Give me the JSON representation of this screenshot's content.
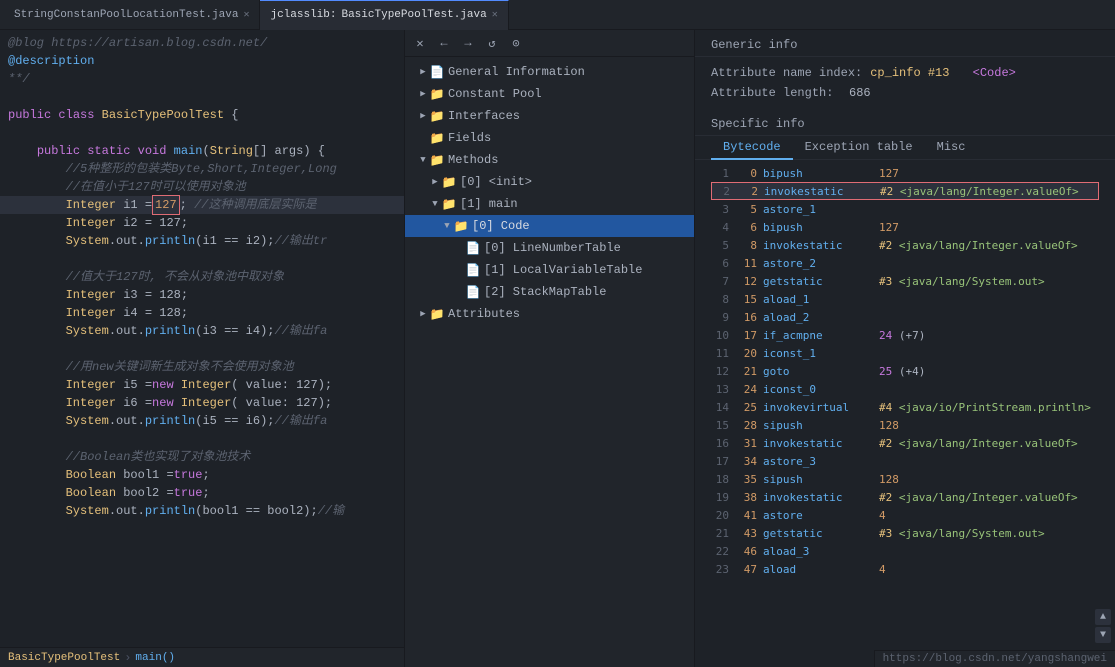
{
  "tabs": [
    {
      "id": "tab1",
      "label": "StringConstanPoolLocationTest.java",
      "active": false,
      "closeable": true
    },
    {
      "id": "tab2",
      "label": "BasicTypePoolTest.java",
      "active": true,
      "closeable": true
    }
  ],
  "tab_prefix": "jclasslib:",
  "toolbar": {
    "close": "✕",
    "back": "←",
    "forward": "→",
    "refresh": "↺",
    "stop": "⊙"
  },
  "tree": {
    "items": [
      {
        "id": "general",
        "label": "General Information",
        "indent": 0,
        "arrow": "▶",
        "icon": "📄",
        "expanded": false
      },
      {
        "id": "constant-pool",
        "label": "Constant Pool",
        "indent": 0,
        "arrow": "▶",
        "icon": "📁",
        "expanded": false
      },
      {
        "id": "interfaces",
        "label": "Interfaces",
        "indent": 0,
        "arrow": "▶",
        "icon": "📁",
        "expanded": false
      },
      {
        "id": "fields",
        "label": "Fields",
        "indent": 0,
        "arrow": "",
        "icon": "📁",
        "expanded": false
      },
      {
        "id": "methods",
        "label": "Methods",
        "indent": 0,
        "arrow": "▼",
        "icon": "📁",
        "expanded": true
      },
      {
        "id": "method-init",
        "label": "[0] <init>",
        "indent": 1,
        "arrow": "▶",
        "icon": "📁",
        "expanded": false
      },
      {
        "id": "method-main",
        "label": "[1] main",
        "indent": 1,
        "arrow": "▼",
        "icon": "📁",
        "expanded": true
      },
      {
        "id": "method-main-code",
        "label": "[0] Code",
        "indent": 2,
        "arrow": "▼",
        "icon": "📁",
        "expanded": true,
        "selected": true
      },
      {
        "id": "line-number-table",
        "label": "[0] LineNumberTable",
        "indent": 3,
        "arrow": "",
        "icon": "📄",
        "expanded": false
      },
      {
        "id": "local-var-table",
        "label": "[1] LocalVariableTable",
        "indent": 3,
        "arrow": "",
        "icon": "📄",
        "expanded": false
      },
      {
        "id": "stack-map-table",
        "label": "[2] StackMapTable",
        "indent": 3,
        "arrow": "",
        "icon": "📄",
        "expanded": false
      },
      {
        "id": "attributes",
        "label": "Attributes",
        "indent": 0,
        "arrow": "▶",
        "icon": "📁",
        "expanded": false
      }
    ]
  },
  "info": {
    "section_title": "Generic info",
    "specific_title": "Specific info",
    "rows": [
      {
        "label": "Attribute name index:",
        "value": "cp_info #13",
        "code": "<Code>"
      },
      {
        "label": "Attribute length:",
        "value": "686"
      }
    ],
    "tabs": [
      "Bytecode",
      "Exception table",
      "Misc"
    ],
    "active_tab": "Bytecode"
  },
  "bytecode": [
    {
      "line": 1,
      "offset": 0,
      "op": "bipush",
      "args": "127",
      "highlight": false
    },
    {
      "line": 2,
      "offset": 2,
      "op": "invokestatic",
      "args": "#2 <java/lang/Integer.valueOf>",
      "highlight": true
    },
    {
      "line": 3,
      "offset": 5,
      "op": "astore_1",
      "args": "",
      "highlight": false
    },
    {
      "line": 4,
      "offset": 6,
      "op": "bipush",
      "args": "127",
      "highlight": false
    },
    {
      "line": 5,
      "offset": 8,
      "op": "invokestatic",
      "args": "#2 <java/lang/Integer.valueOf>",
      "highlight": false
    },
    {
      "line": 6,
      "offset": 11,
      "op": "astore_2",
      "args": "",
      "highlight": false
    },
    {
      "line": 7,
      "offset": 12,
      "op": "getstatic",
      "args": "#3 <java/lang/System.out>",
      "highlight": false
    },
    {
      "line": 8,
      "offset": 15,
      "op": "aload_1",
      "args": "",
      "highlight": false
    },
    {
      "line": 9,
      "offset": 16,
      "op": "aload_2",
      "args": "",
      "highlight": false
    },
    {
      "line": 10,
      "offset": 17,
      "op": "if_acmpne",
      "args": "24 (+7)",
      "highlight": false
    },
    {
      "line": 11,
      "offset": 20,
      "op": "iconst_1",
      "args": "",
      "highlight": false
    },
    {
      "line": 12,
      "offset": 21,
      "op": "goto",
      "args": "25 (+4)",
      "highlight": false
    },
    {
      "line": 13,
      "offset": 24,
      "op": "iconst_0",
      "args": "",
      "highlight": false
    },
    {
      "line": 14,
      "offset": 25,
      "op": "invokevirtual",
      "args": "#4 <java/io/PrintStream.println>",
      "highlight": false
    },
    {
      "line": 15,
      "offset": 28,
      "op": "sipush",
      "args": "128",
      "highlight": false
    },
    {
      "line": 16,
      "offset": 31,
      "op": "invokestatic",
      "args": "#2 <java/lang/Integer.valueOf>",
      "highlight": false
    },
    {
      "line": 17,
      "offset": 34,
      "op": "astore_3",
      "args": "",
      "highlight": false
    },
    {
      "line": 18,
      "offset": 35,
      "op": "sipush",
      "args": "128",
      "highlight": false
    },
    {
      "line": 19,
      "offset": 38,
      "op": "invokestatic",
      "args": "#2 <java/lang/Integer.valueOf>",
      "highlight": false
    },
    {
      "line": 20,
      "offset": 41,
      "op": "astore",
      "args": "4",
      "highlight": false
    },
    {
      "line": 21,
      "offset": 43,
      "op": "getstatic",
      "args": "#3 <java/lang/System.out>",
      "highlight": false
    },
    {
      "line": 22,
      "offset": 46,
      "op": "aload_3",
      "args": "",
      "highlight": false
    },
    {
      "line": 23,
      "offset": 47,
      "op": "aload",
      "args": "4",
      "highlight": false
    }
  ],
  "code": {
    "lines": [
      {
        "text": "@blog https://artisan.blog.csdn.net/",
        "type": "comment"
      },
      {
        "text": "@description",
        "type": "comment-tag"
      },
      {
        "text": "**/",
        "type": "comment"
      },
      {
        "text": "",
        "type": "blank"
      },
      {
        "text": "public class BasicTypePoolTest {",
        "type": "code"
      },
      {
        "text": "",
        "type": "blank"
      },
      {
        "text": "    public static void main(String[] args) {",
        "type": "code"
      },
      {
        "text": "        //5种整形的包装类Byte,Short,Integer,Long",
        "type": "comment"
      },
      {
        "text": "        //在值小于127时可以使用对象池",
        "type": "comment"
      },
      {
        "text": "        Integer i1 = 127;  //这种调用底层实际是",
        "type": "code-highlight"
      },
      {
        "text": "        Integer i2 = 127;",
        "type": "code"
      },
      {
        "text": "        System.out.println(i1 == i2);//输出tr",
        "type": "code"
      },
      {
        "text": "",
        "type": "blank"
      },
      {
        "text": "        //值大于127时, 不会从对象池中取对象",
        "type": "comment"
      },
      {
        "text": "        Integer i3 = 128;",
        "type": "code"
      },
      {
        "text": "        Integer i4 = 128;",
        "type": "code"
      },
      {
        "text": "        System.out.println(i3 == i4);//输出fa",
        "type": "code"
      },
      {
        "text": "",
        "type": "blank"
      },
      {
        "text": "        //用new关键词新生成对象不会使用对象池",
        "type": "comment"
      },
      {
        "text": "        Integer i5 = new Integer( value: 127);",
        "type": "code"
      },
      {
        "text": "        Integer i6 = new Integer( value: 127);",
        "type": "code"
      },
      {
        "text": "        System.out.println(i5 == i6);//输出fa",
        "type": "code"
      },
      {
        "text": "",
        "type": "blank"
      },
      {
        "text": "        //Boolean类也实现了对象池技术",
        "type": "comment"
      },
      {
        "text": "        Boolean bool1 = true;",
        "type": "code"
      },
      {
        "text": "        Boolean bool2 = true;",
        "type": "code"
      },
      {
        "text": "        System.out.println(bool1 == bool2);//输",
        "type": "code"
      }
    ]
  },
  "breadcrumb": {
    "class": "BasicTypePoolTest",
    "method": "main()"
  },
  "status_url": "https://blog.csdn.net/yangshangwei"
}
